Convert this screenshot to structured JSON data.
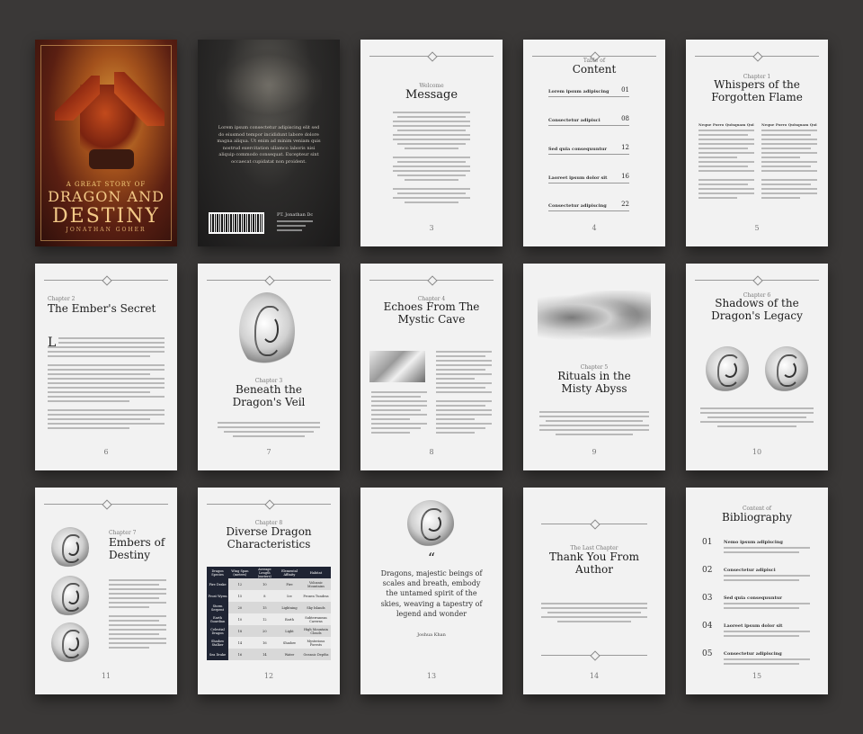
{
  "cover": {
    "subtitle": "A GREAT STORY OF",
    "title_line1": "DRAGON AND",
    "title_line2": "DESTINY",
    "author": "JONATHAN GOHER"
  },
  "back_cover": {
    "blurb": "Lorem ipsum consectetur adipiscing elit sed do eiusmod tempor incididunt labore dolore magna aliqua. Ut enim ad minim veniam quis nostrud exercitation ullamco laboris nisi aliquip commodo consequat. Excepteur sint occaecat cupidatat non proident.",
    "publisher": "PT. Jonathan Dc"
  },
  "pages": {
    "p3": {
      "kicker": "Welcome",
      "title": "Message",
      "num": "3"
    },
    "p4": {
      "kicker": "Table of",
      "title": "Content",
      "num": "4",
      "entries": [
        {
          "title": "Lorem ipsum adipiscing",
          "page": "01"
        },
        {
          "title": "Consectetur adipisci",
          "page": "08"
        },
        {
          "title": "Sed quia consequuntur",
          "page": "12"
        },
        {
          "title": "Laoreet ipsum dolor sit",
          "page": "16"
        },
        {
          "title": "Consectetur adipiscing",
          "page": "22"
        }
      ]
    },
    "p5": {
      "kicker": "Chapter 1",
      "title": "Whispers of the Forgotten Flame",
      "num": "5",
      "col_head": "Neque Porro Quisquam Qui"
    },
    "p6": {
      "kicker": "Chapter 2",
      "title": "The Ember's Secret",
      "num": "6"
    },
    "p7": {
      "kicker": "Chapter 3",
      "title": "Beneath the Dragon's Veil",
      "num": "7"
    },
    "p8": {
      "kicker": "Chapter 4",
      "title": "Echoes From The Mystic Cave",
      "num": "8"
    },
    "p9": {
      "kicker": "Chapter 5",
      "title": "Rituals in the Misty Abyss",
      "num": "9"
    },
    "p10": {
      "kicker": "Chapter 6",
      "title": "Shadows of the Dragon's Legacy",
      "num": "10"
    },
    "p11": {
      "kicker": "Chapter 7",
      "title": "Embers of Destiny",
      "num": "11"
    },
    "p12": {
      "kicker": "Chapter 8",
      "title": "Diverse Dragon Characteristics",
      "num": "12",
      "headers": [
        "Dragon Species",
        "Wing Span (meters)",
        "Average Length (meters)",
        "Elemental Affinity",
        "Habitat"
      ],
      "rows": [
        [
          "Fire Drake",
          "12",
          "10",
          "Fire",
          "Volcanic Mountains"
        ],
        [
          "Frost Wyrm",
          "15",
          "8",
          "Ice",
          "Frozen Tundras"
        ],
        [
          "Storm Serpent",
          "20",
          "15",
          "Lightning",
          "Sky Islands"
        ],
        [
          "Earth Guardian",
          "10",
          "12",
          "Earth",
          "Subterranean Caverns"
        ],
        [
          "Celestial Dragon",
          "18",
          "20",
          "Light",
          "High Mountain Clouds"
        ],
        [
          "Shadow Stalker",
          "14",
          "16",
          "Shadow",
          "Mysterious Forests"
        ],
        [
          "Sea Drake",
          "16",
          "14",
          "Water",
          "Oceanic Depths"
        ]
      ]
    },
    "p13": {
      "quote_mark": "“",
      "quote": "Dragons, majestic beings of scales and breath, embody the untamed spirit of the skies, weaving a tapestry of legend and wonder",
      "attribution": "Joshua Khan",
      "num": "13"
    },
    "p14": {
      "kicker": "The Last Chapter",
      "title": "Thank You From Author",
      "num": "14"
    },
    "p15": {
      "kicker": "Content of",
      "title": "Bibliography",
      "num": "15",
      "entries": [
        {
          "n": "01",
          "title": "Nemo ipsum adipiscing"
        },
        {
          "n": "02",
          "title": "Consectetur adipisci"
        },
        {
          "n": "03",
          "title": "Sed quia consequuntur"
        },
        {
          "n": "04",
          "title": "Laoreet ipsum dolor sit"
        },
        {
          "n": "05",
          "title": "Consectetur adipiscing"
        }
      ]
    }
  }
}
